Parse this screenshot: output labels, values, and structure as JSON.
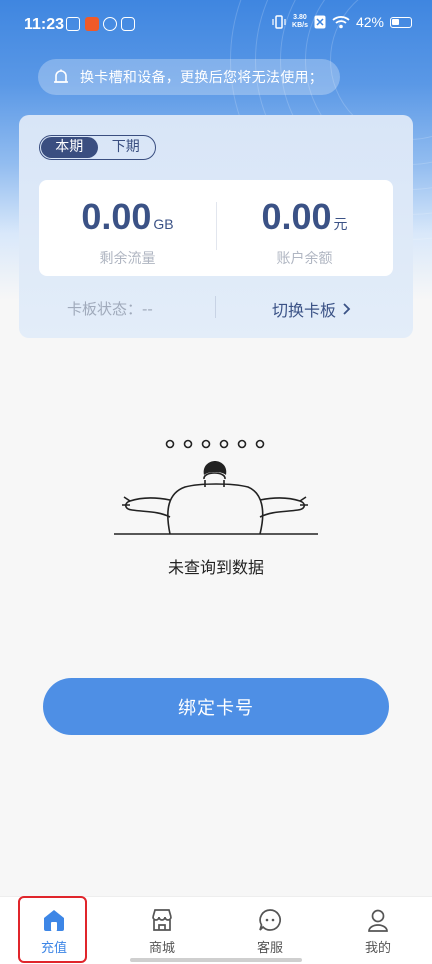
{
  "status_bar": {
    "time": "11:23",
    "net_speed_value": "3.80",
    "net_speed_unit": "KB/s",
    "battery": "42%"
  },
  "notice": {
    "text": "换卡槽和设备，更换后您将无法使用；",
    "icon": "bell-icon"
  },
  "card": {
    "tabs": [
      "本期",
      "下期"
    ],
    "active_tab": "本期",
    "data_remaining": {
      "value": "0.00",
      "unit": "GB",
      "label": "剩余流量"
    },
    "balance": {
      "value": "0.00",
      "unit": "元",
      "label": "账户余额"
    },
    "board_status": "卡板状态：--",
    "switch_board": "切换卡板",
    "switch_icon": "chevron-right-icon"
  },
  "empty_state": {
    "text": "未查询到数据"
  },
  "bind_button": "绑定卡号",
  "tabbar": {
    "items": [
      {
        "label": "充值",
        "icon": "home-icon",
        "active": true
      },
      {
        "label": "商城",
        "icon": "shop-icon",
        "active": false
      },
      {
        "label": "客服",
        "icon": "chat-icon",
        "active": false
      },
      {
        "label": "我的",
        "icon": "user-icon",
        "active": false
      }
    ]
  },
  "colors": {
    "accent": "#4e8fe5",
    "navy": "#3b5286",
    "highlight": "#e0252b"
  }
}
